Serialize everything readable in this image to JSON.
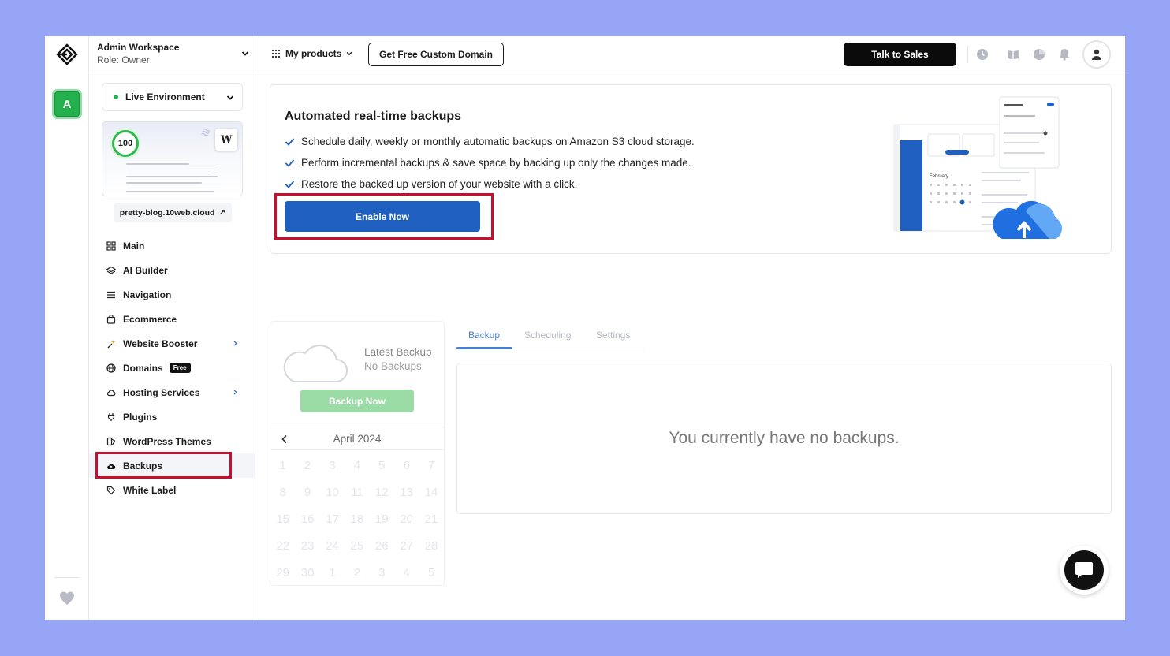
{
  "colors": {
    "page_background": "#96a5f5",
    "primary_button": "#1f5fbf",
    "highlight_box": "#c8102e",
    "status_green": "#22b14c",
    "backup_now_button": "#9bdba6",
    "active_tab": "#4a7fcf"
  },
  "rail": {
    "avatar_letter": "A"
  },
  "workspace": {
    "name": "Admin Workspace",
    "role": "Role: Owner"
  },
  "environment": {
    "label": "Live Environment"
  },
  "site": {
    "score": "100",
    "link": "pretty-blog.10web.cloud",
    "link_icon": "↗"
  },
  "nav": {
    "items": [
      {
        "label": "Main",
        "icon": "grid-icon"
      },
      {
        "label": "AI Builder",
        "icon": "layers-icon"
      },
      {
        "label": "Navigation",
        "icon": "menu-icon"
      },
      {
        "label": "Ecommerce",
        "icon": "shopping-bag-icon"
      },
      {
        "label": "Website Booster",
        "icon": "sparkle-icon"
      },
      {
        "label": "Domains",
        "icon": "globe-icon",
        "badge": "Free"
      },
      {
        "label": "Hosting Services",
        "icon": "cloud-icon"
      },
      {
        "label": "Plugins",
        "icon": "plug-icon"
      },
      {
        "label": "WordPress Themes",
        "icon": "theme-icon"
      },
      {
        "label": "Backups",
        "icon": "cloud-backup-icon"
      },
      {
        "label": "White Label",
        "icon": "tag-icon"
      }
    ],
    "active": "Backups"
  },
  "topbar": {
    "products_label": "My products",
    "domain_button": "Get Free Custom Domain",
    "sales_button": "Talk to Sales",
    "icons": [
      "clock-icon",
      "book-icon",
      "pie-chart-icon",
      "bell-icon",
      "user-icon"
    ]
  },
  "promo": {
    "title": "Automated real-time backups",
    "bullets": [
      "Schedule daily, weekly or monthly automatic backups on Amazon S3 cloud storage.",
      "Perform incremental backups & save space by backing up only the changes made.",
      "Restore the backed up version of your website with a click."
    ],
    "button": "Enable Now"
  },
  "latest_backup": {
    "title": "Latest Backup",
    "status": "No Backups",
    "button": "Backup Now"
  },
  "calendar": {
    "month": "April 2024",
    "days": [
      "1",
      "2",
      "3",
      "4",
      "5",
      "6",
      "7",
      "8",
      "9",
      "10",
      "11",
      "12",
      "13",
      "14",
      "15",
      "16",
      "17",
      "18",
      "19",
      "20",
      "21",
      "22",
      "23",
      "24",
      "25",
      "26",
      "27",
      "28",
      "29",
      "30",
      "1",
      "2",
      "3",
      "4",
      "5"
    ]
  },
  "tabs": {
    "items": [
      "Backup",
      "Scheduling",
      "Settings"
    ],
    "active": "Backup"
  },
  "empty_state": "You currently have no backups."
}
